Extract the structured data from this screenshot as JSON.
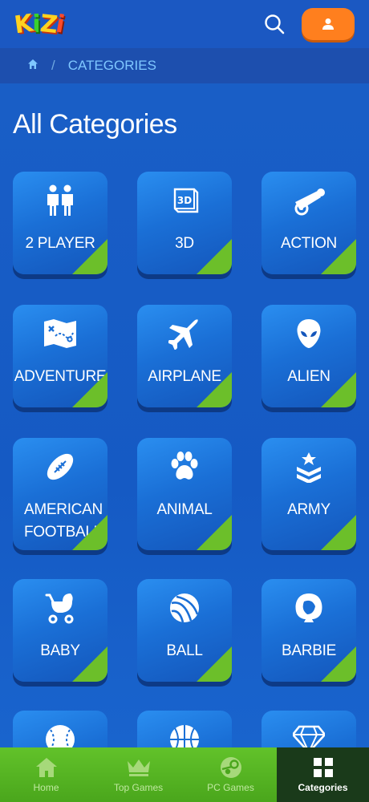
{
  "header": {
    "logo": {
      "text": "KiZi"
    }
  },
  "breadcrumb": {
    "separator": "/",
    "current": "CATEGORIES"
  },
  "page": {
    "title": "All Categories"
  },
  "categories": [
    {
      "label": "2 PLAYER",
      "icon": "two-people-icon"
    },
    {
      "label": "3D",
      "icon": "3d-cube-icon"
    },
    {
      "label": "ACTION",
      "icon": "cannon-icon"
    },
    {
      "label": "ADVENTURE",
      "icon": "treasure-map-icon"
    },
    {
      "label": "AIRPLANE",
      "icon": "airplane-icon"
    },
    {
      "label": "ALIEN",
      "icon": "alien-icon"
    },
    {
      "label": "AMERICAN FOOTBALL",
      "icon": "football-icon"
    },
    {
      "label": "ANIMAL",
      "icon": "paw-icon"
    },
    {
      "label": "ARMY",
      "icon": "army-badge-icon"
    },
    {
      "label": "BABY",
      "icon": "stroller-icon"
    },
    {
      "label": "BALL",
      "icon": "beach-ball-icon"
    },
    {
      "label": "BARBIE",
      "icon": "barbie-head-icon"
    },
    {
      "label": "",
      "icon": "baseball-icon"
    },
    {
      "label": "",
      "icon": "basketball-icon"
    },
    {
      "label": "",
      "icon": "diamond-icon"
    }
  ],
  "bottom_nav": [
    {
      "label": "Home",
      "icon": "home-icon",
      "active": false
    },
    {
      "label": "Top Games",
      "icon": "crown-icon",
      "active": false
    },
    {
      "label": "PC Games",
      "icon": "steam-icon",
      "active": false
    },
    {
      "label": "Categories",
      "icon": "grid-icon",
      "active": true
    }
  ],
  "colors": {
    "background": "#1a5fc7",
    "tile_corner": "#6cbf2a",
    "user_button": "#ff7f1e",
    "bottom_nav": "#5ab823",
    "breadcrumb_text": "#7fc7ff"
  }
}
